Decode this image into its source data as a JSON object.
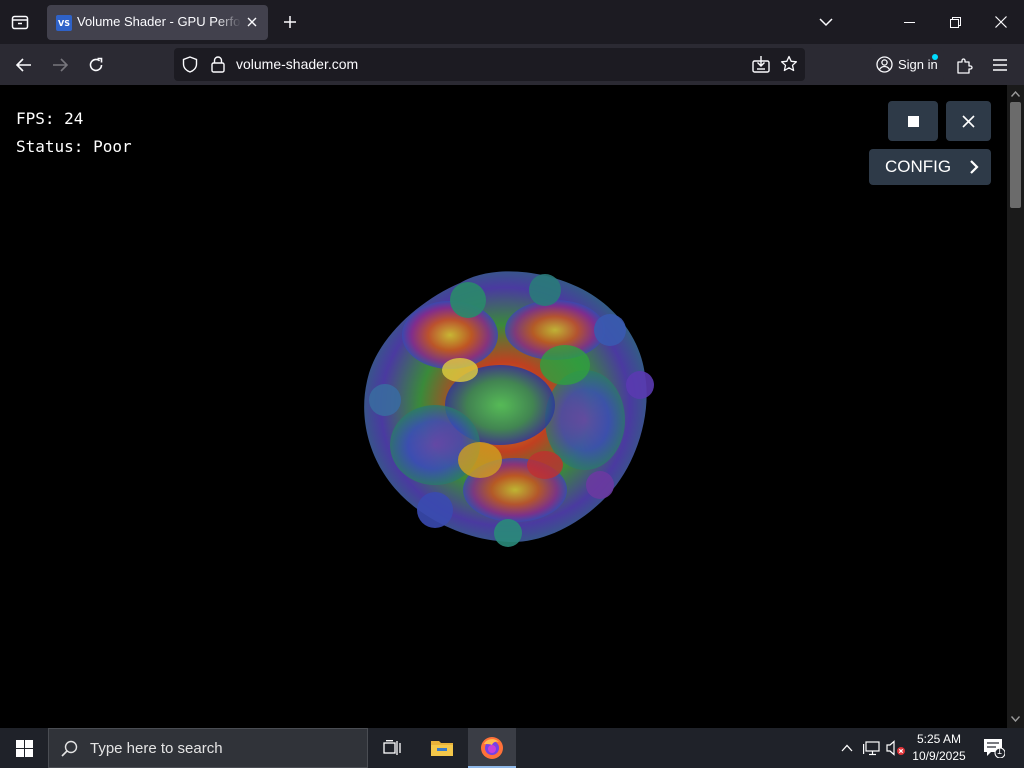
{
  "browser": {
    "tab_title": "Volume Shader - GPU Performance Test",
    "favicon_text": "VS",
    "url": "volume-shader.com",
    "signin_label": "Sign in"
  },
  "page": {
    "fps_label": "FPS: 24",
    "status_label": "Status: Poor",
    "config_label": "CONFIG"
  },
  "taskbar": {
    "search_placeholder": "Type here to search",
    "time": "5:25 AM",
    "date": "10/9/2025",
    "notification_count": "1"
  },
  "colors": {
    "tabstrip_bg": "#1c1b22",
    "toolbar_bg": "#2b2a33",
    "button_bg": "#2e3a48",
    "taskbar_bg": "#1f2229"
  }
}
